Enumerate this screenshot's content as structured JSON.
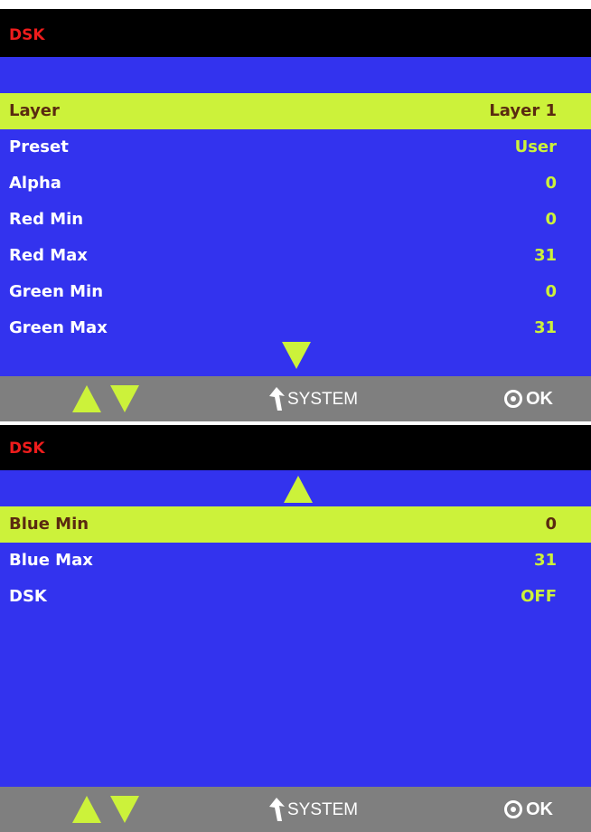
{
  "screens": [
    {
      "title": "DSK",
      "rows": [
        {
          "label": "Layer",
          "value": "Layer 1",
          "selected": true
        },
        {
          "label": "Preset",
          "value": "User"
        },
        {
          "label": "Alpha",
          "value": "0"
        },
        {
          "label": "Red Min",
          "value": "0"
        },
        {
          "label": "Red Max",
          "value": "31"
        },
        {
          "label": "Green Min",
          "value": "0"
        },
        {
          "label": "Green Max",
          "value": "31"
        }
      ],
      "scroll": "down-arrow-icon",
      "footer": {
        "back_label": "SYSTEM",
        "ok_label": "OK"
      }
    },
    {
      "title": "DSK",
      "rows": [
        {
          "label": "Blue Min",
          "value": "0",
          "selected": true
        },
        {
          "label": "Blue Max",
          "value": "31"
        },
        {
          "label": "DSK",
          "value": "OFF"
        }
      ],
      "scroll": "up-arrow-icon",
      "footer": {
        "back_label": "SYSTEM",
        "ok_label": "OK"
      }
    }
  ],
  "colors": {
    "panel_background": "#3333ee",
    "title_bar": "#000000",
    "title_text": "#ee1c1c",
    "highlight": "#ccf23a",
    "highlight_text": "#5a2a10",
    "label_text": "#ffffff",
    "value_text": "#ccf23a",
    "footer_bar": "#7f7f7f"
  }
}
